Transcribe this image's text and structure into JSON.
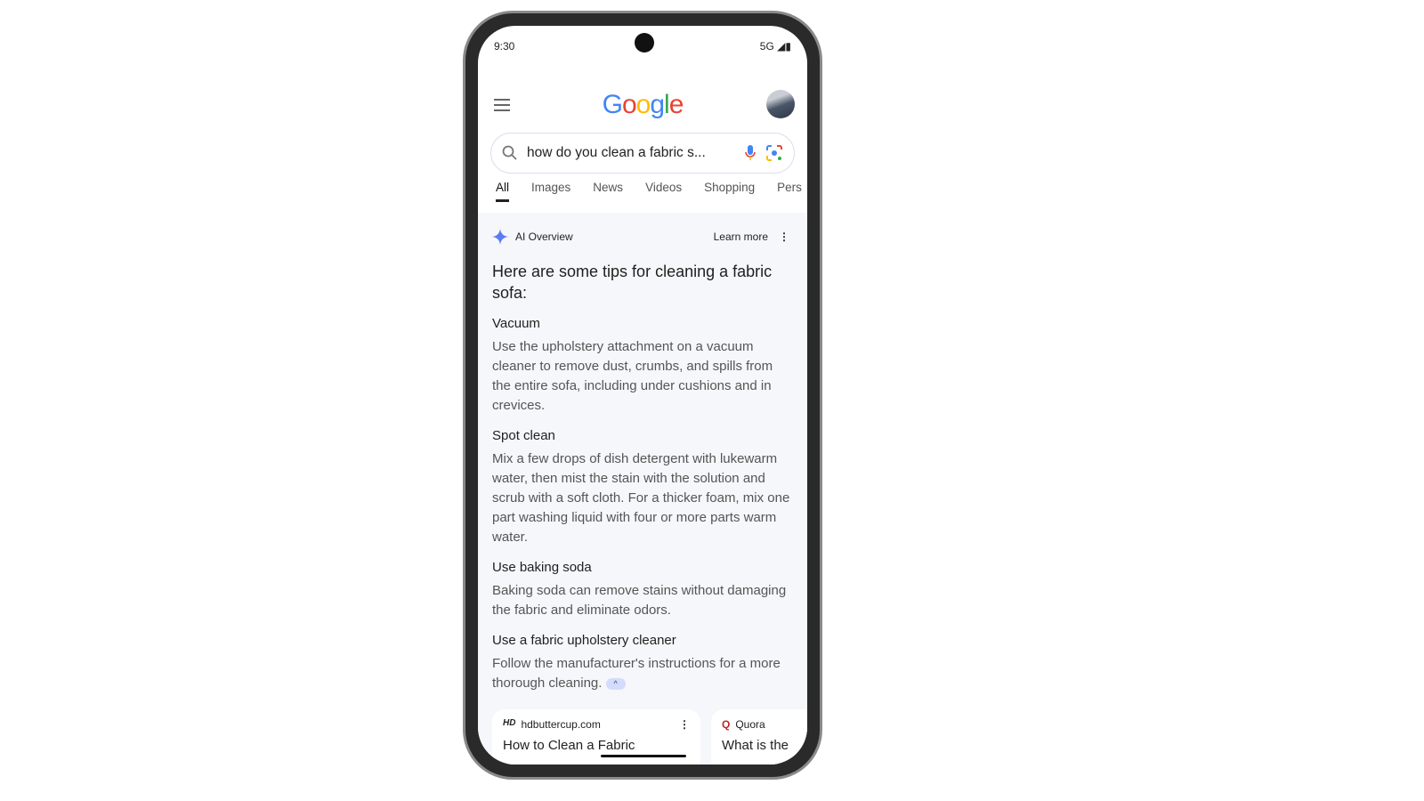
{
  "status": {
    "time": "9:30",
    "network": "5G"
  },
  "header": {
    "logo": "Google"
  },
  "search": {
    "query": "how do you clean a fabric s..."
  },
  "tabs": [
    "All",
    "Images",
    "News",
    "Videos",
    "Shopping",
    "Pers"
  ],
  "ai": {
    "label": "AI Overview",
    "learn_more": "Learn more",
    "intro": "Here are some tips for cleaning a fabric sofa:",
    "sections": [
      {
        "title": "Vacuum",
        "body": "Use the upholstery attachment on a vacuum cleaner to remove dust, crumbs, and spills from the entire sofa, including under cushions and in crevices."
      },
      {
        "title": "Spot clean",
        "body": "Mix a few drops of dish detergent with lukewarm water, then mist the stain with the solution and scrub with a soft cloth. For a thicker foam, mix one part washing liquid with four or more parts warm water."
      },
      {
        "title": "Use baking soda",
        "body": "Baking soda can remove stains without damaging the fabric and eliminate odors."
      },
      {
        "title": "Use a fabric upholstery cleaner",
        "body": "Follow the manufacturer's instructions for a more thorough cleaning."
      }
    ]
  },
  "sources": [
    {
      "site": "hdbuttercup.com",
      "title": "How to Clean a Fabric"
    },
    {
      "site": "Quora",
      "title": "What is the"
    }
  ]
}
